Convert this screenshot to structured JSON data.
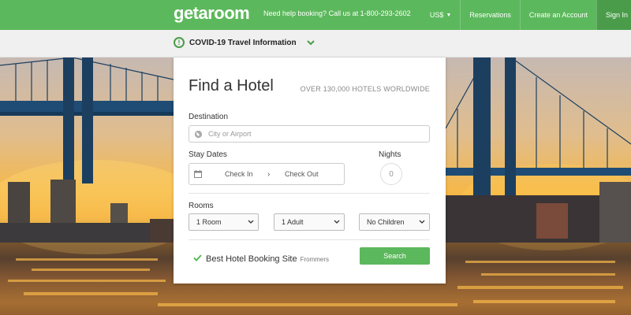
{
  "header": {
    "logo_text": "getaroom",
    "helpline": "Need help booking? Call us at 1-800-293-2602",
    "nav": {
      "currency": "US$",
      "reservations": "Reservations",
      "create_account": "Create an Account",
      "sign_in": "Sign In"
    }
  },
  "covid_banner": {
    "icon": "exclamation-circle-icon",
    "label": "COVID-19 Travel Information",
    "toggle_icon": "chevron-down-icon"
  },
  "search_panel": {
    "title": "Find a Hotel",
    "subtitle": "OVER 130,000 HOTELS WORLDWIDE",
    "destination": {
      "label": "Destination",
      "placeholder": "City or Airport",
      "icon": "globe-icon"
    },
    "stay_dates": {
      "label": "Stay Dates",
      "check_in": "Check In",
      "check_out": "Check Out",
      "icon": "calendar-icon"
    },
    "nights": {
      "label": "Nights",
      "value": "0"
    },
    "rooms": {
      "label": "Rooms",
      "rooms_selected": "1 Room",
      "adults_selected": "1 Adult",
      "children_selected": "No Children"
    },
    "badge": {
      "text": "Best Hotel Booking Site",
      "source": "Frommers"
    },
    "search_button": "Search"
  },
  "colors": {
    "brand_green": "#5cb85c",
    "dark_green": "#4a9c4a"
  }
}
